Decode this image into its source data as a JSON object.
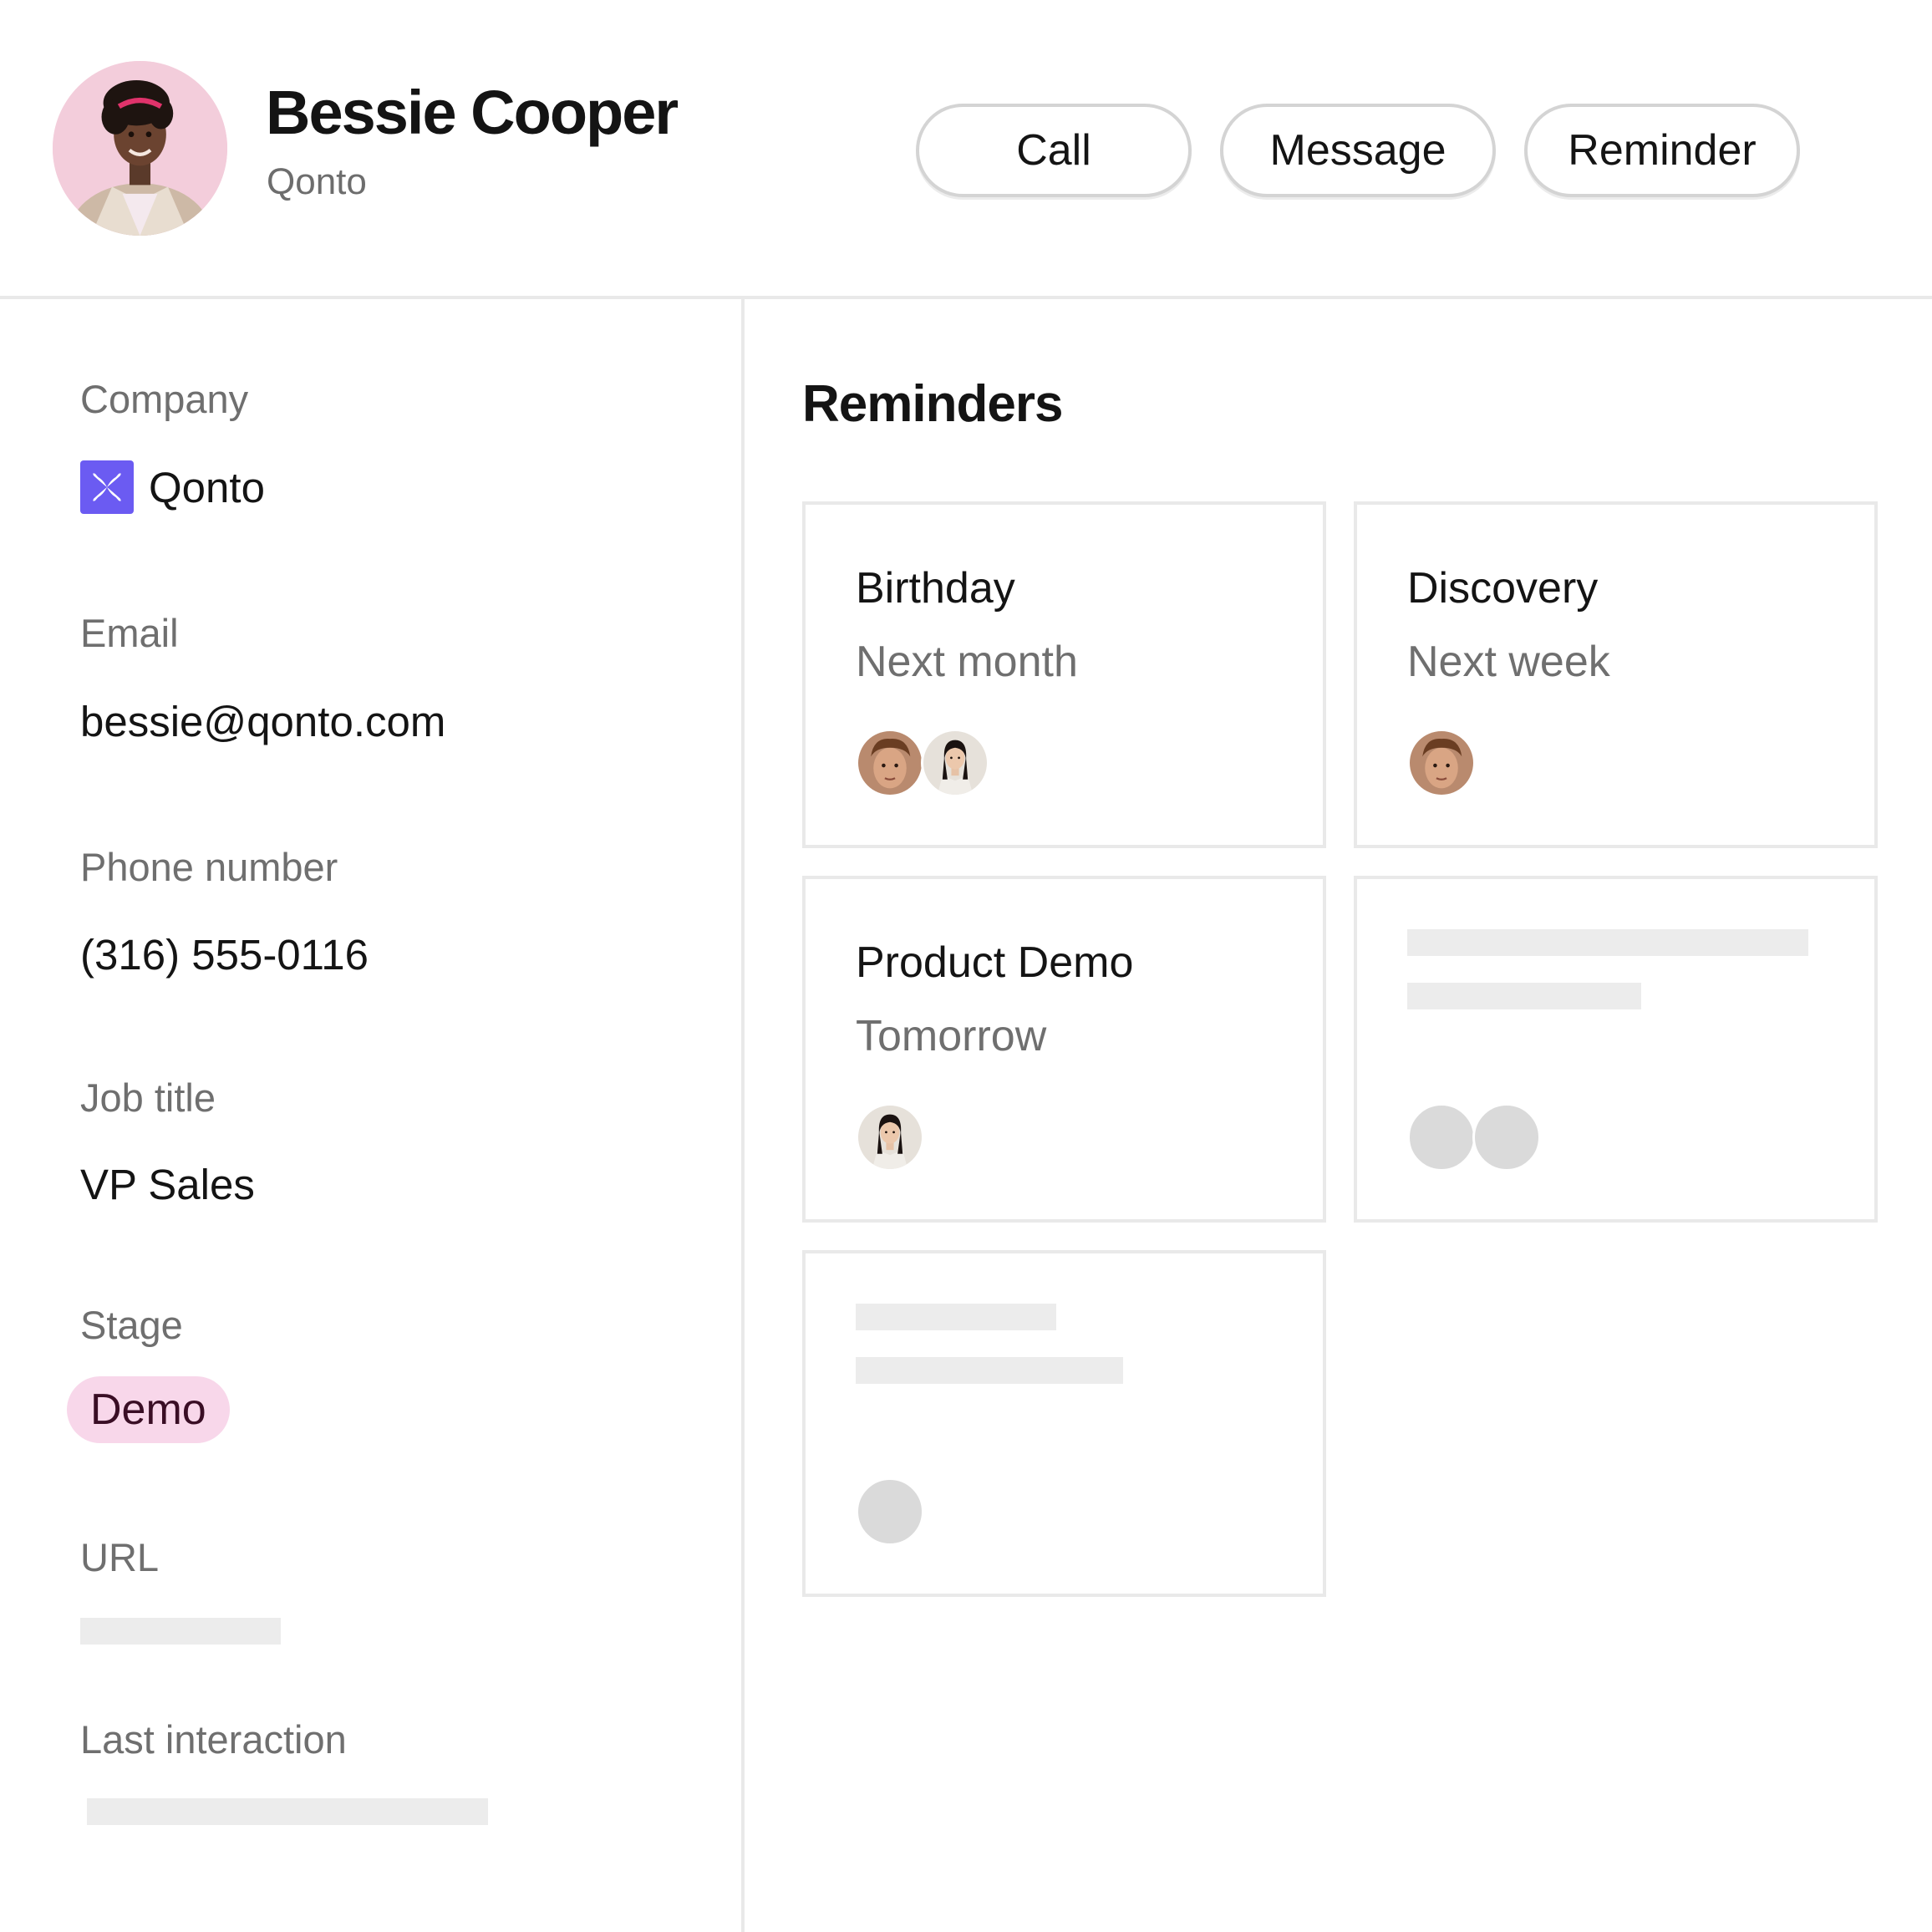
{
  "contact": {
    "name": "Bessie Cooper",
    "company": "Qonto"
  },
  "actions": {
    "call": "Call",
    "message": "Message",
    "reminder": "Reminder"
  },
  "details": {
    "company_label": "Company",
    "company_value": "Qonto",
    "email_label": "Email",
    "email_value": "bessie@qonto.com",
    "phone_label": "Phone number",
    "phone_value": "(316) 555-0116",
    "job_label": "Job title",
    "job_value": "VP Sales",
    "stage_label": "Stage",
    "stage_value": "Demo",
    "url_label": "URL",
    "last_interaction_label": "Last interaction"
  },
  "reminders": {
    "title": "Reminders",
    "items": [
      {
        "title": "Birthday",
        "when": "Next month",
        "people": [
          "man-avatar",
          "woman-avatar"
        ]
      },
      {
        "title": "Discovery",
        "when": "Next week",
        "people": [
          "man-avatar"
        ]
      },
      {
        "title": "Product Demo",
        "when": "Tomorrow",
        "people": [
          "woman-avatar"
        ]
      }
    ]
  },
  "colors": {
    "accent_brand": "#6b5bf2",
    "stage_badge_bg": "#f8d7ea",
    "stage_badge_text": "#3a0e25",
    "muted_text": "#6f6f6f",
    "border": "#e9e9e9",
    "skeleton": "#ececec"
  }
}
